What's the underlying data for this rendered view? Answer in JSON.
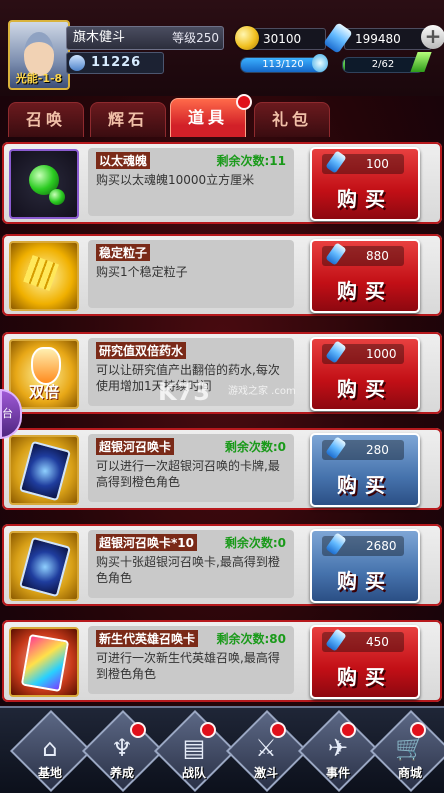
{
  "player": {
    "name": "旗木健斗",
    "level": "等级250",
    "power": "11226",
    "badge": "光能-1-8"
  },
  "currency": {
    "gold": "30100",
    "gems": "199480"
  },
  "bars": {
    "stamina": {
      "text": "113/120",
      "fraction": 0.94
    },
    "energy": {
      "text": "2/62",
      "fraction": 0.03
    }
  },
  "tabs": [
    "召唤",
    "辉石",
    "道具",
    "礼包"
  ],
  "active_tab": 2,
  "items": [
    {
      "name": "以太魂魄",
      "remain": "剩余次数:11",
      "desc": "购买以太魂魄10000立方厘米",
      "price": "100",
      "buy": "购买",
      "color": "red"
    },
    {
      "name": "稳定粒子",
      "remain": "",
      "desc": "购买1个稳定粒子",
      "price": "880",
      "buy": "购买",
      "color": "red"
    },
    {
      "name": "研究值双倍药水",
      "remain": "",
      "desc": "可以让研究值产出翻倍的药水,每次使用增加1天持续时间",
      "price": "1000",
      "buy": "购买",
      "color": "red"
    },
    {
      "name": "超银河召唤卡",
      "remain": "剩余次数:0",
      "desc": "可以进行一次超银河召唤的卡牌,最高得到橙色角色",
      "price": "280",
      "buy": "购买",
      "color": "blue"
    },
    {
      "name": "超银河召唤卡*10",
      "remain": "剩余次数:0",
      "desc": "购买十张超银河召唤卡,最高得到橙色角色",
      "price": "2680",
      "buy": "购买",
      "color": "blue"
    },
    {
      "name": "新生代英雄召唤卡",
      "remain": "剩余次数:80",
      "desc": "可进行一次新生代英雄召唤,最高得到橙色角色",
      "price": "450",
      "buy": "购买",
      "color": "red"
    }
  ],
  "icon_labels": {
    "double": "双倍"
  },
  "side_tab": "台",
  "watermark": {
    "main": "K73",
    "sub": "游戏之家 .com"
  },
  "nav": [
    {
      "label": "基地",
      "icon": "base-icon"
    },
    {
      "label": "养成",
      "icon": "train-icon"
    },
    {
      "label": "战队",
      "icon": "team-icon"
    },
    {
      "label": "激斗",
      "icon": "battle-icon"
    },
    {
      "label": "事件",
      "icon": "event-icon"
    },
    {
      "label": "商城",
      "icon": "cart-icon"
    }
  ],
  "colors": {
    "buy_red": "#c20f16",
    "buy_blue": "#4673ad",
    "tab_active": "#d22028",
    "remain_green": "#1a9a1a"
  }
}
